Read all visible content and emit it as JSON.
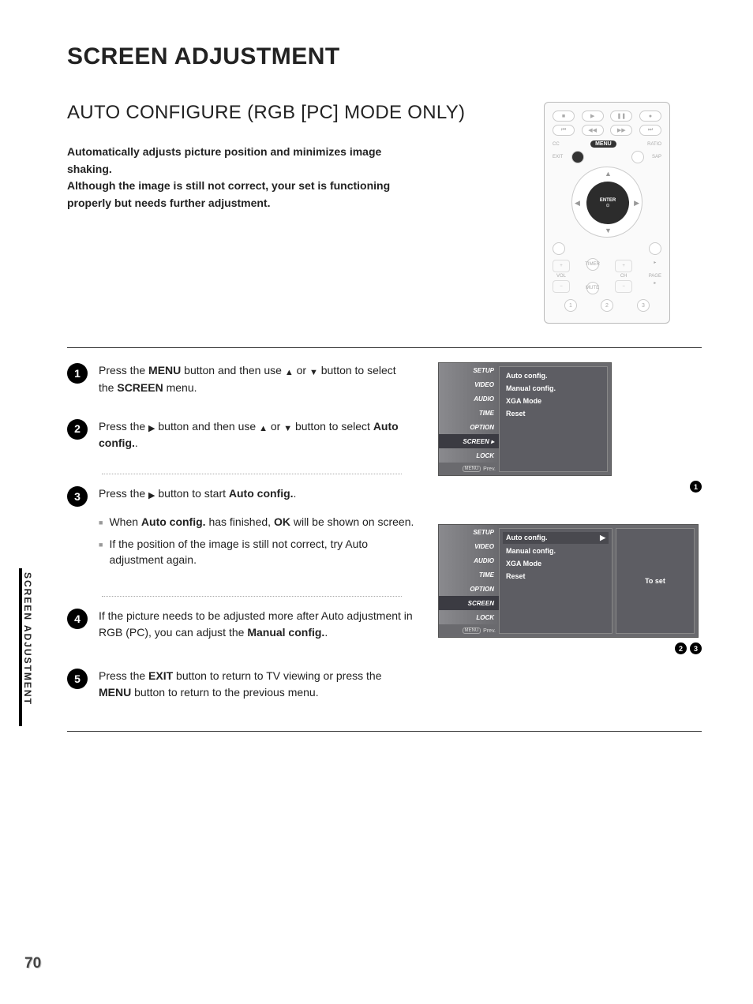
{
  "page_title": "SCREEN ADJUSTMENT",
  "section_title": "AUTO CONFIGURE (RGB [PC] MODE ONLY)",
  "intro_line1": "Automatically adjusts picture position and minimizes image shaking.",
  "intro_line2": "Although the image is still not correct, your set is functioning properly but needs further adjustment.",
  "side_tab": "SCREEN ADJUSTMENT",
  "page_number": "70",
  "remote": {
    "cc": "CC",
    "menu": "MENU",
    "ratio": "RATIO",
    "exit": "EXIT",
    "sap": "SAP",
    "enter": "ENTER",
    "enter_sub": "⊙",
    "vol": "VOL",
    "ch": "CH",
    "page": "PAGE",
    "timer": "TIMER",
    "mute": "MUTE",
    "num1": "1",
    "num2": "2",
    "num3": "3"
  },
  "steps": {
    "s1a": "Press the ",
    "s1b": "MENU",
    "s1c": " button and then use ",
    "s1d": " or ",
    "s1e": " button to select the ",
    "s1f": "SCREEN",
    "s1g": " menu.",
    "s2a": "Press the ",
    "s2b": " button and then use ",
    "s2c": " or ",
    "s2d": " button to select ",
    "s2e": "Auto config.",
    "s2f": ".",
    "s3a": "Press the ",
    "s3b": " button to start ",
    "s3c": "Auto config.",
    "s3d": ".",
    "b1a": "When ",
    "b1b": "Auto config.",
    "b1c": " has finished, ",
    "b1d": "OK",
    "b1e": " will be shown on screen.",
    "b2": "If the position of the image is still not correct, try Auto adjustment again.",
    "s4a": "If the picture needs to be adjusted more after Auto adjustment in RGB (PC), you can adjust the ",
    "s4b": "Manual config.",
    "s4c": ".",
    "s5a": "Press the ",
    "s5b": "EXIT",
    "s5c": " button to return to TV viewing or press the ",
    "s5d": "MENU",
    "s5e": " button to return to the previous menu."
  },
  "osd_menu_items": [
    "SETUP",
    "VIDEO",
    "AUDIO",
    "TIME",
    "OPTION",
    "SCREEN",
    "LOCK"
  ],
  "osd_prev": "Prev.",
  "osd_panel": {
    "auto": "Auto config.",
    "manual": "Manual config.",
    "xga": "XGA Mode",
    "reset": "Reset"
  },
  "osd_hint": "To set",
  "marks": {
    "m1": "1",
    "m2": "2",
    "m3": "3"
  }
}
